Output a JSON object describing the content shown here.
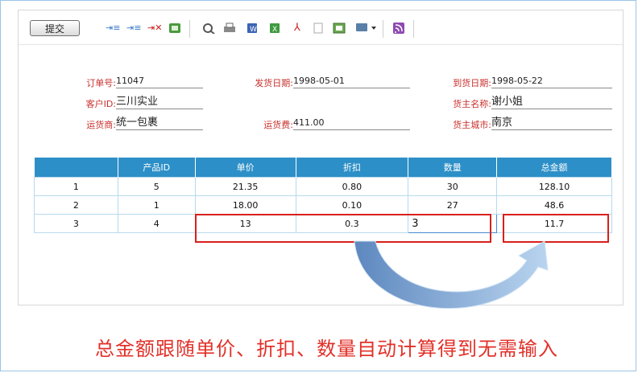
{
  "toolbar": {
    "submit_label": "提交",
    "icons": [
      "insert-row-icon",
      "insert-row-after-icon",
      "delete-row-icon",
      "export-excel-icon",
      "preview-icon",
      "print-icon",
      "word-icon",
      "excel-icon",
      "pdf-icon",
      "text-icon",
      "image-icon",
      "screen-dropdown-icon",
      "rss-icon"
    ]
  },
  "order": {
    "order_no_label": "订单号:",
    "order_no": "11047",
    "ship_date_label": "发货日期:",
    "ship_date": "1998-05-01",
    "arrive_date_label": "到货日期:",
    "arrive_date": "1998-05-22",
    "customer_label": "客户ID:",
    "customer": "三川实业",
    "consignee_label": "货主名称:",
    "consignee": "谢小姐",
    "carrier_label": "运货商:",
    "carrier": "统一包裹",
    "freight_label": "运货费:",
    "freight": "411.00",
    "city_label": "货主城市:",
    "city": "南京"
  },
  "table": {
    "headers": [
      "",
      "产品ID",
      "单价",
      "折扣",
      "数量",
      "总金额"
    ],
    "rows": [
      [
        "1",
        "5",
        "21.35",
        "0.80",
        "30",
        "128.10"
      ],
      [
        "2",
        "1",
        "18.00",
        "0.10",
        "27",
        "48.6"
      ],
      [
        "3",
        "4",
        "13",
        "0.3",
        "3",
        "11.7"
      ]
    ]
  },
  "caption": "总金额跟随单价、折扣、数量自动计算得到无需输入",
  "colors": {
    "header_bg": "#2d8fc7",
    "highlight": "#d8201c",
    "label": "#c8302c",
    "arrow": "#6a9bcf"
  }
}
